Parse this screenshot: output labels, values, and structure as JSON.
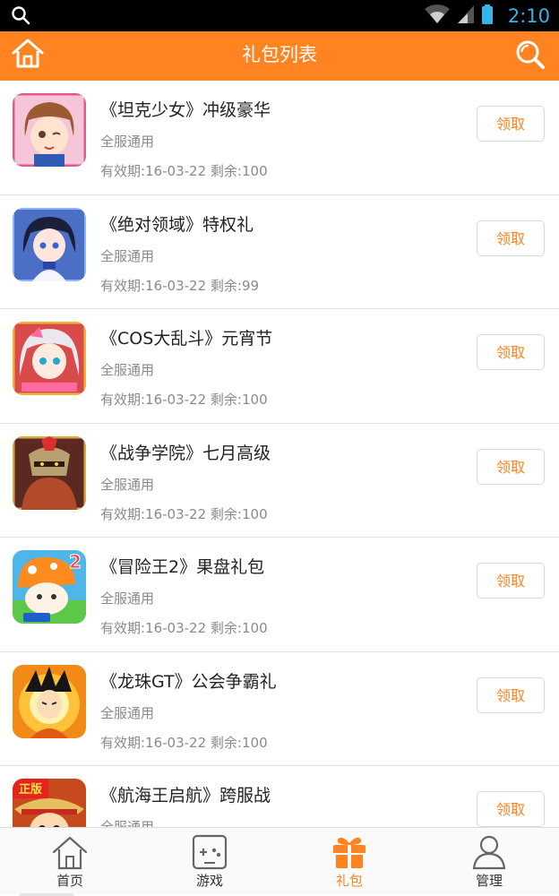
{
  "status_bar": {
    "time": "2:10"
  },
  "header": {
    "title": "礼包列表"
  },
  "gifts": [
    {
      "title": "《坦克少女》冲级豪华",
      "scope": "全服通用",
      "validity": "有效期:16-03-22",
      "remaining": "剩余:100",
      "button": "领取"
    },
    {
      "title": "《绝对领域》特权礼",
      "scope": "全服通用",
      "validity": "有效期:16-03-22",
      "remaining": "剩余:99",
      "button": "领取"
    },
    {
      "title": "《COS大乱斗》元宵节",
      "scope": "全服通用",
      "validity": "有效期:16-03-22",
      "remaining": "剩余:100",
      "button": "领取"
    },
    {
      "title": "《战争学院》七月高级",
      "scope": "全服通用",
      "validity": "有效期:16-03-22",
      "remaining": "剩余:100",
      "button": "领取"
    },
    {
      "title": "《冒险王2》果盘礼包",
      "scope": "全服通用",
      "validity": "有效期:16-03-22",
      "remaining": "剩余:100",
      "button": "领取"
    },
    {
      "title": "《龙珠GT》公会争霸礼",
      "scope": "全服通用",
      "validity": "有效期:16-03-22",
      "remaining": "剩余:100",
      "button": "领取"
    },
    {
      "title": "《航海王启航》跨服战",
      "scope": "全服通用",
      "validity": "",
      "remaining": "",
      "button": "领取"
    }
  ],
  "thumb_badges": {
    "adventure": "2",
    "onepiece": "正版"
  },
  "bottom_nav": [
    {
      "label": "首页",
      "icon": "home-icon",
      "active": false
    },
    {
      "label": "游戏",
      "icon": "gamepad-icon",
      "active": false
    },
    {
      "label": "礼包",
      "icon": "gift-icon",
      "active": true
    },
    {
      "label": "管理",
      "icon": "user-icon",
      "active": false
    }
  ],
  "colors": {
    "accent": "#ff8320",
    "status_text": "#33b5e5"
  }
}
